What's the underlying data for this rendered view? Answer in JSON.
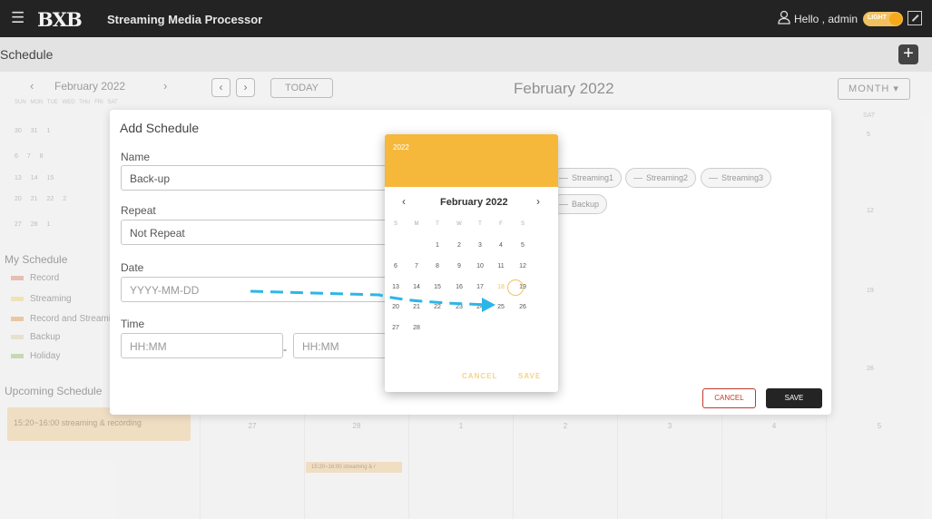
{
  "header": {
    "logo": "BXB",
    "app_name": "Streaming Media Processor",
    "greeting": "Hello , admin",
    "theme_label": "LIGHT"
  },
  "schedule_bar": {
    "title": "Schedule",
    "add_label": "+"
  },
  "mini_calendar": {
    "month": "February 2022",
    "weekdays": "SUN MON TUE WED THU FRI SAT",
    "rows": [
      "30 31 1",
      "6 7 8",
      "13 14 15",
      "20 21 22 2",
      "27 28 1"
    ]
  },
  "my_schedule": {
    "title": "My Schedule",
    "items": [
      {
        "label": "Record",
        "color": "#d99c8b"
      },
      {
        "label": "Streaming",
        "color": "#e3d48e"
      },
      {
        "label": "Record and Streaming",
        "color": "#e1a870"
      },
      {
        "label": "Backup",
        "color": "#d9d2b5"
      },
      {
        "label": "Holiday",
        "color": "#a9c48c"
      }
    ]
  },
  "upcoming": {
    "title": "Upcoming Schedule",
    "card": "15:20~16:00  streaming & recording"
  },
  "calendar": {
    "today_label": "TODAY",
    "title": "February 2022",
    "view_label": "MONTH",
    "sat_label": "SAT",
    "sat_days": [
      "5",
      "12",
      "19",
      "26"
    ],
    "last_row": [
      "27",
      "28",
      "1",
      "2",
      "3",
      "4",
      "5"
    ],
    "event": "15:20~16:00  streaming & r"
  },
  "dialog": {
    "title": "Add Schedule",
    "name_label": "Name",
    "name_value": "Back-up",
    "repeat_label": "Repeat",
    "repeat_value": "Not Repeat",
    "date_label": "Date",
    "date_placeholder": "YYYY-MM-DD",
    "time_label": "Time",
    "start_placeholder": "HH:MM",
    "end_placeholder": "HH:MM",
    "time_separator": "-",
    "chips": [
      "Streaming1",
      "Streaming2",
      "Streaming3",
      "Backup"
    ],
    "cancel_label": "CANCEL",
    "save_label": "SAVE"
  },
  "picker": {
    "year": "2022",
    "month": "February 2022",
    "dow": [
      "S",
      "M",
      "T",
      "W",
      "T",
      "F",
      "S"
    ],
    "weeks": [
      [
        "",
        "",
        "1",
        "2",
        "3",
        "4",
        "5"
      ],
      [
        "6",
        "7",
        "8",
        "9",
        "10",
        "11",
        "12"
      ],
      [
        "13",
        "14",
        "15",
        "16",
        "17",
        "18",
        "19"
      ],
      [
        "20",
        "21",
        "22",
        "23",
        "24",
        "25",
        "26"
      ],
      [
        "27",
        "28",
        "",
        "",
        "",
        "",
        ""
      ]
    ],
    "selected": "18",
    "cancel_label": "CANCEL",
    "save_label": "SAVE"
  }
}
